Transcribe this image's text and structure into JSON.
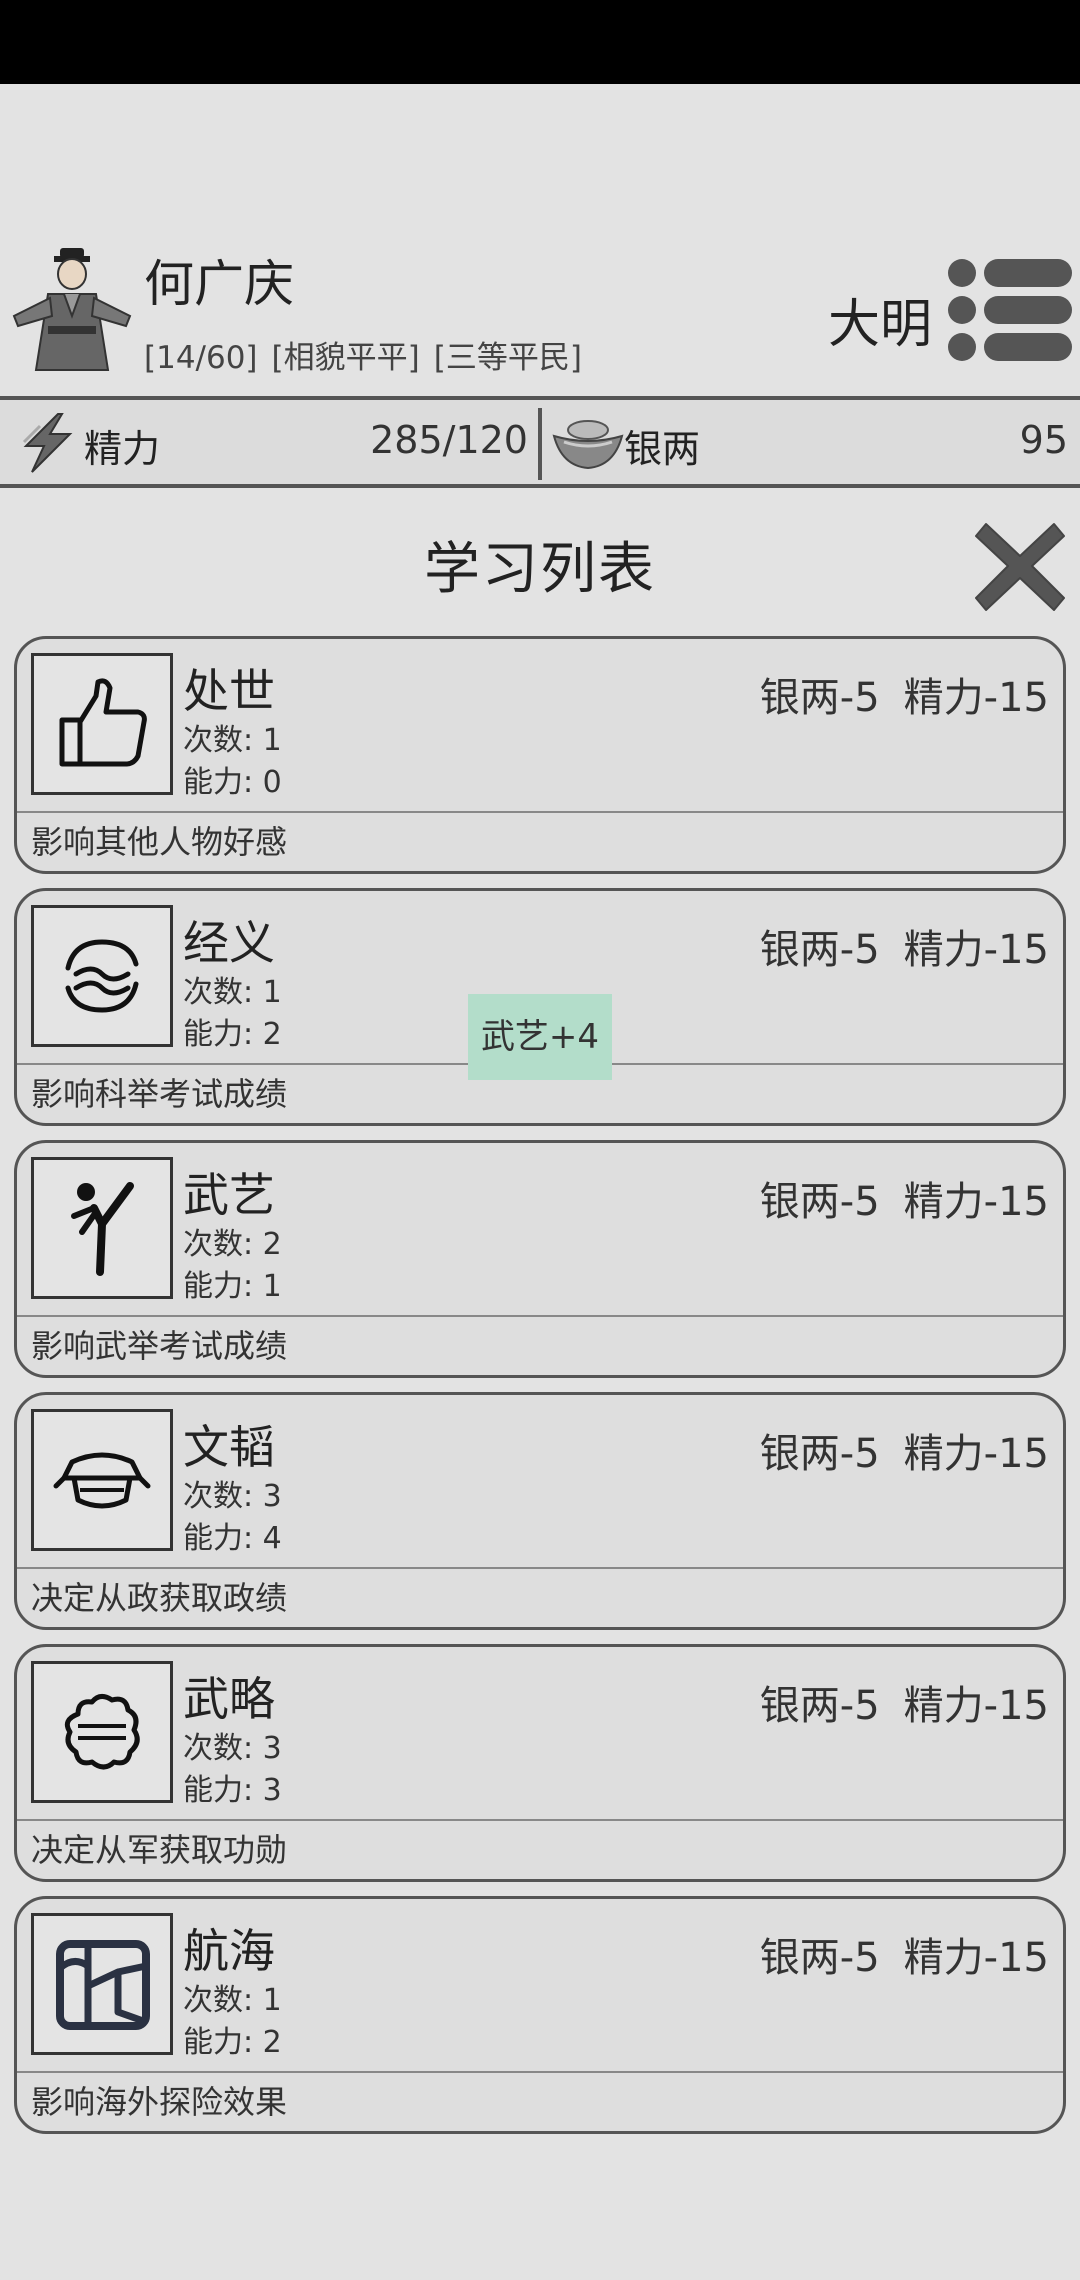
{
  "character": {
    "name": "何广庆",
    "tags": [
      "[14/60]",
      "[相貌平平]",
      "[三等平民]"
    ],
    "dynasty": "大明"
  },
  "resources": {
    "energy": {
      "label": "精力",
      "value": "285/120",
      "icon": "lightning-icon"
    },
    "silver": {
      "label": "银两",
      "value": "95",
      "icon": "silver-ingot-icon"
    }
  },
  "panel": {
    "title": "学习列表"
  },
  "skills": [
    {
      "name": "处世",
      "count": "次数: 1",
      "ability": "能力: 0",
      "cost_silver": "银两-5",
      "cost_energy": "精力-15",
      "desc": "影响其他人物好感",
      "icon": "thumbs-up-icon"
    },
    {
      "name": "经义",
      "count": "次数: 1",
      "ability": "能力: 2",
      "cost_silver": "银两-5",
      "cost_energy": "精力-15",
      "desc": "影响科举考试成绩",
      "icon": "scholar-swirl-icon"
    },
    {
      "name": "武艺",
      "count": "次数: 2",
      "ability": "能力: 1",
      "cost_silver": "银两-5",
      "cost_energy": "精力-15",
      "desc": "影响武举考试成绩",
      "icon": "martial-kick-icon"
    },
    {
      "name": "文韬",
      "count": "次数: 3",
      "ability": "能力: 4",
      "cost_silver": "银两-5",
      "cost_energy": "精力-15",
      "desc": "决定从政获取政绩",
      "icon": "official-hat-icon"
    },
    {
      "name": "武略",
      "count": "次数: 3",
      "ability": "能力: 3",
      "cost_silver": "银两-5",
      "cost_energy": "精力-15",
      "desc": "决定从军获取功勋",
      "icon": "brain-strategy-icon"
    },
    {
      "name": "航海",
      "count": "次数: 1",
      "ability": "能力: 2",
      "cost_silver": "银两-5",
      "cost_energy": "精力-15",
      "desc": "影响海外探险效果",
      "icon": "sea-map-icon"
    }
  ],
  "toast": {
    "text": "武艺+4"
  },
  "colors": {
    "background": "#e3e3e3",
    "border": "#555555",
    "toast": "#b3ddca",
    "status_bar": "#000000"
  }
}
